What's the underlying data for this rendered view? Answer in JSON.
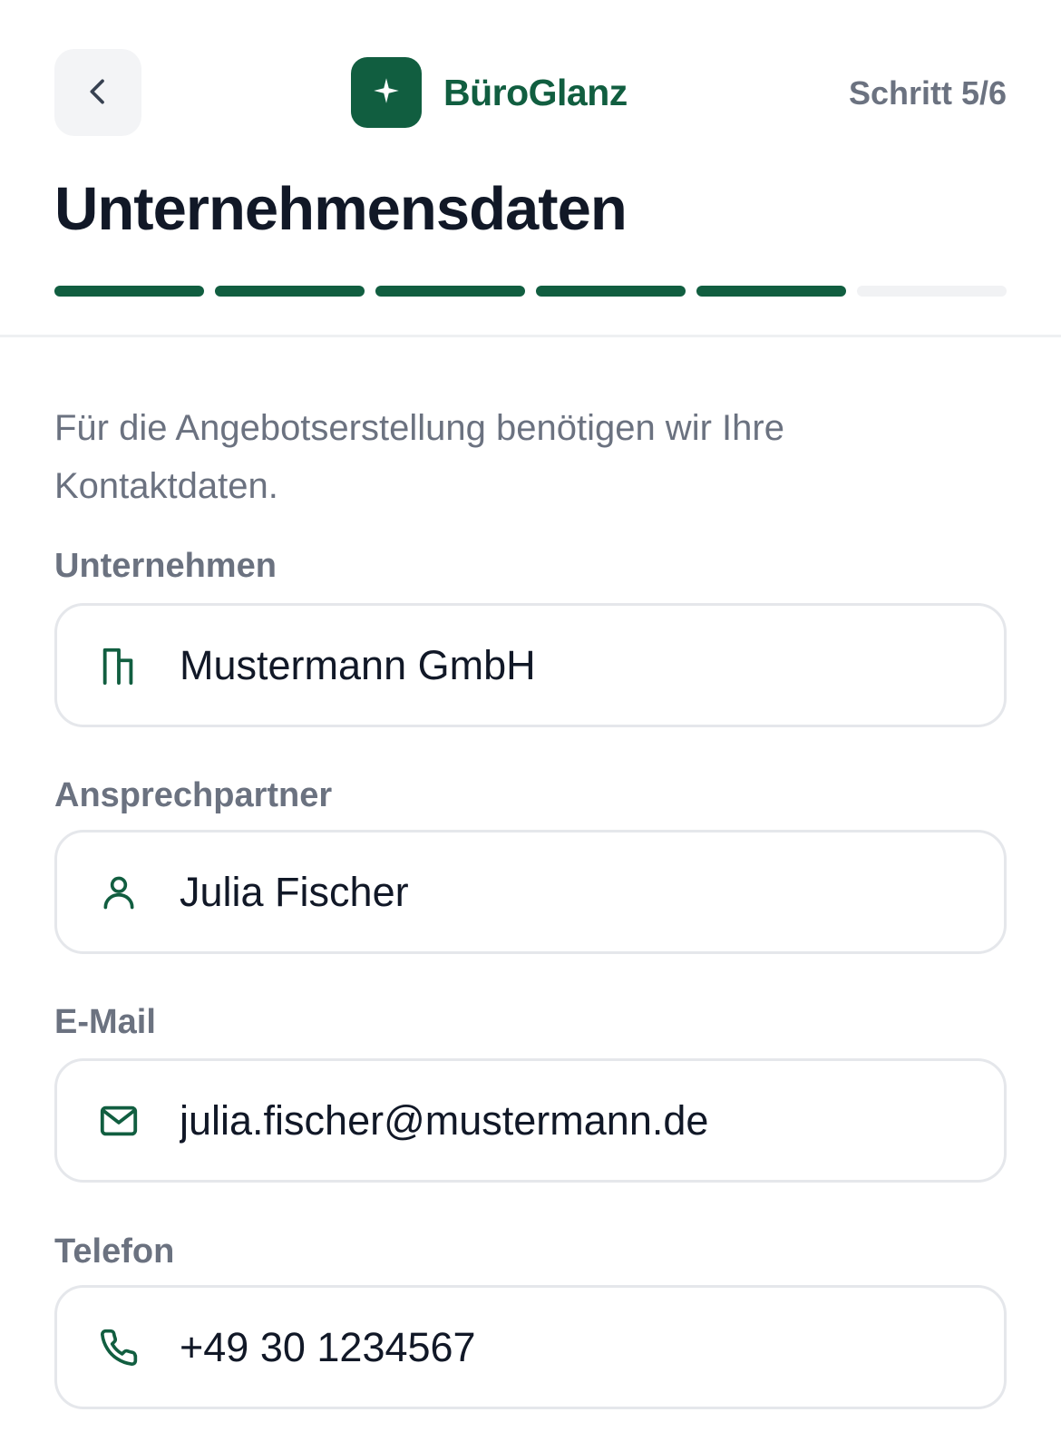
{
  "header": {
    "brand_name": "BüroGlanz",
    "step_label": "Schritt 5/6",
    "title": "Unternehmensdaten",
    "back_icon": "chevron-left-icon",
    "logo_icon": "sparkle-icon"
  },
  "progress": {
    "total_steps": 6,
    "completed_steps": 5
  },
  "intro_text": "Für die Angebotserstellung benötigen wir Ihre Kontaktdaten.",
  "fields": [
    {
      "label": "Unternehmen",
      "value": "Mustermann GmbH",
      "icon": "building-icon"
    },
    {
      "label": "Ansprechpartner",
      "value": "Julia Fischer",
      "icon": "user-icon"
    },
    {
      "label": "E-Mail",
      "value": "julia.fischer@mustermann.de",
      "icon": "mail-icon"
    },
    {
      "label": "Telefon",
      "value": "+49 30 1234567",
      "icon": "phone-icon"
    }
  ],
  "colors": {
    "brand_green": "#115e40",
    "progress_inactive": "#f1f2f4",
    "text_muted": "#6b7280",
    "text_dark": "#111827"
  }
}
